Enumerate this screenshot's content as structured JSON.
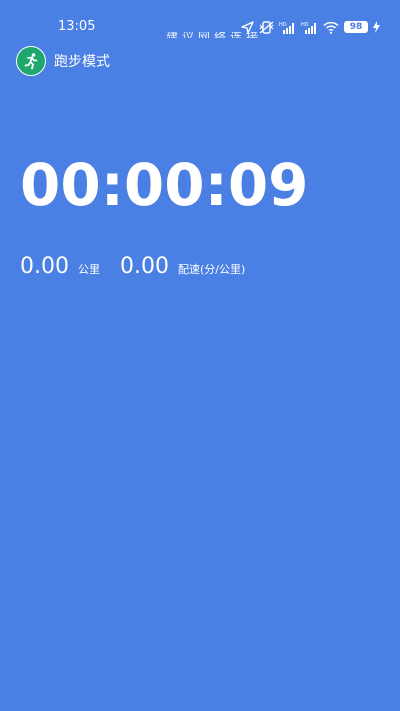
{
  "status_bar": {
    "time": "13:05",
    "battery": "98",
    "partial_text": "建议网络连接"
  },
  "header": {
    "title": "跑步模式",
    "logo_icon": "running-person-icon"
  },
  "timer": {
    "value": "00:00:09"
  },
  "stats": {
    "distance_value": "0.00",
    "distance_unit": "公里",
    "pace_value": "0.00",
    "pace_unit": "配速(分/公里)"
  },
  "colors": {
    "background": "#4a7fe3",
    "logo_bg": "#1ea86e",
    "text": "#ffffff"
  }
}
